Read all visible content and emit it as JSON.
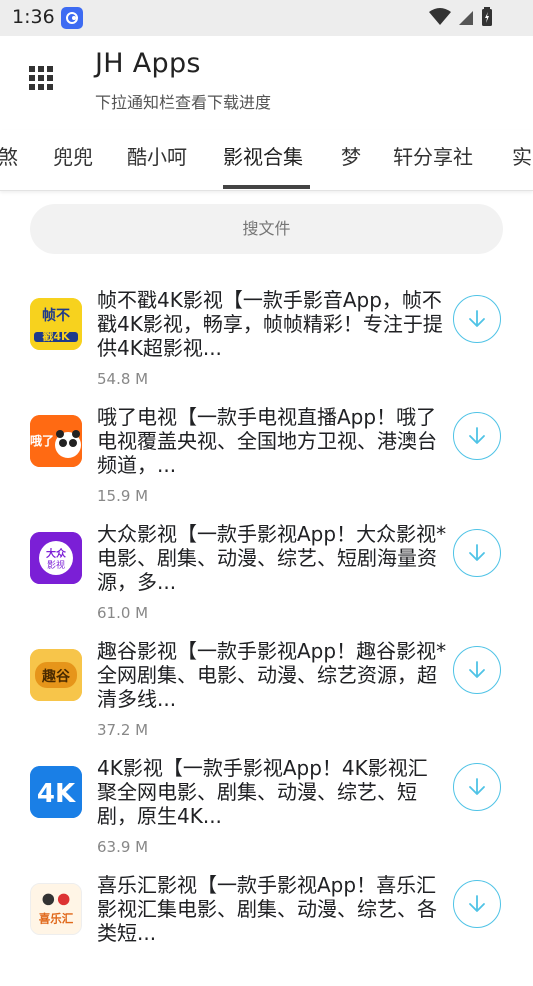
{
  "status": {
    "time": "1:36"
  },
  "header": {
    "title": "JH Apps",
    "subtitle": "下拉通知栏查看下载进度"
  },
  "tabs": [
    {
      "label": "煞"
    },
    {
      "label": "兜兜"
    },
    {
      "label": "酷小呵"
    },
    {
      "label": "影视合集",
      "active": true
    },
    {
      "label": "梦"
    },
    {
      "label": "轩分享社"
    },
    {
      "label": "实"
    }
  ],
  "search": {
    "placeholder": "搜文件"
  },
  "apps": [
    {
      "desc": "帧不戳4K影视【一款手影音App，帧不戳4K影视，畅享，帧帧精彩！专注于提供4K超影视...",
      "size": "54.8 M",
      "icon_label": "帧不戳4K"
    },
    {
      "desc": "哦了电视【一款手电视直播App！哦了电视覆盖央视、全国地方卫视、港澳台频道，...",
      "size": "15.9 M",
      "icon_label": "哦了"
    },
    {
      "desc": "大众影视【一款手影视App！大众影视*电影、剧集、动漫、综艺、短剧海量资源，多...",
      "size": "61.0 M",
      "icon_label": "大众影视"
    },
    {
      "desc": "趣谷影视【一款手影视App！趣谷影视*全网剧集、电影、动漫、综艺资源，超清多线...",
      "size": "37.2 M",
      "icon_label": "趣谷"
    },
    {
      "desc": "4K影视【一款手影视App！4K影视汇聚全网电影、剧集、动漫、综艺、短剧，原生4K...",
      "size": "63.9 M",
      "icon_label": "4K"
    },
    {
      "desc": "喜乐汇影视【一款手影视App！喜乐汇影视汇集电影、剧集、动漫、综艺、各类短...",
      "size": "",
      "icon_label": "喜乐汇"
    }
  ],
  "colors": {
    "accent": "#4fc3e6",
    "tab_indicator": "#444444"
  }
}
